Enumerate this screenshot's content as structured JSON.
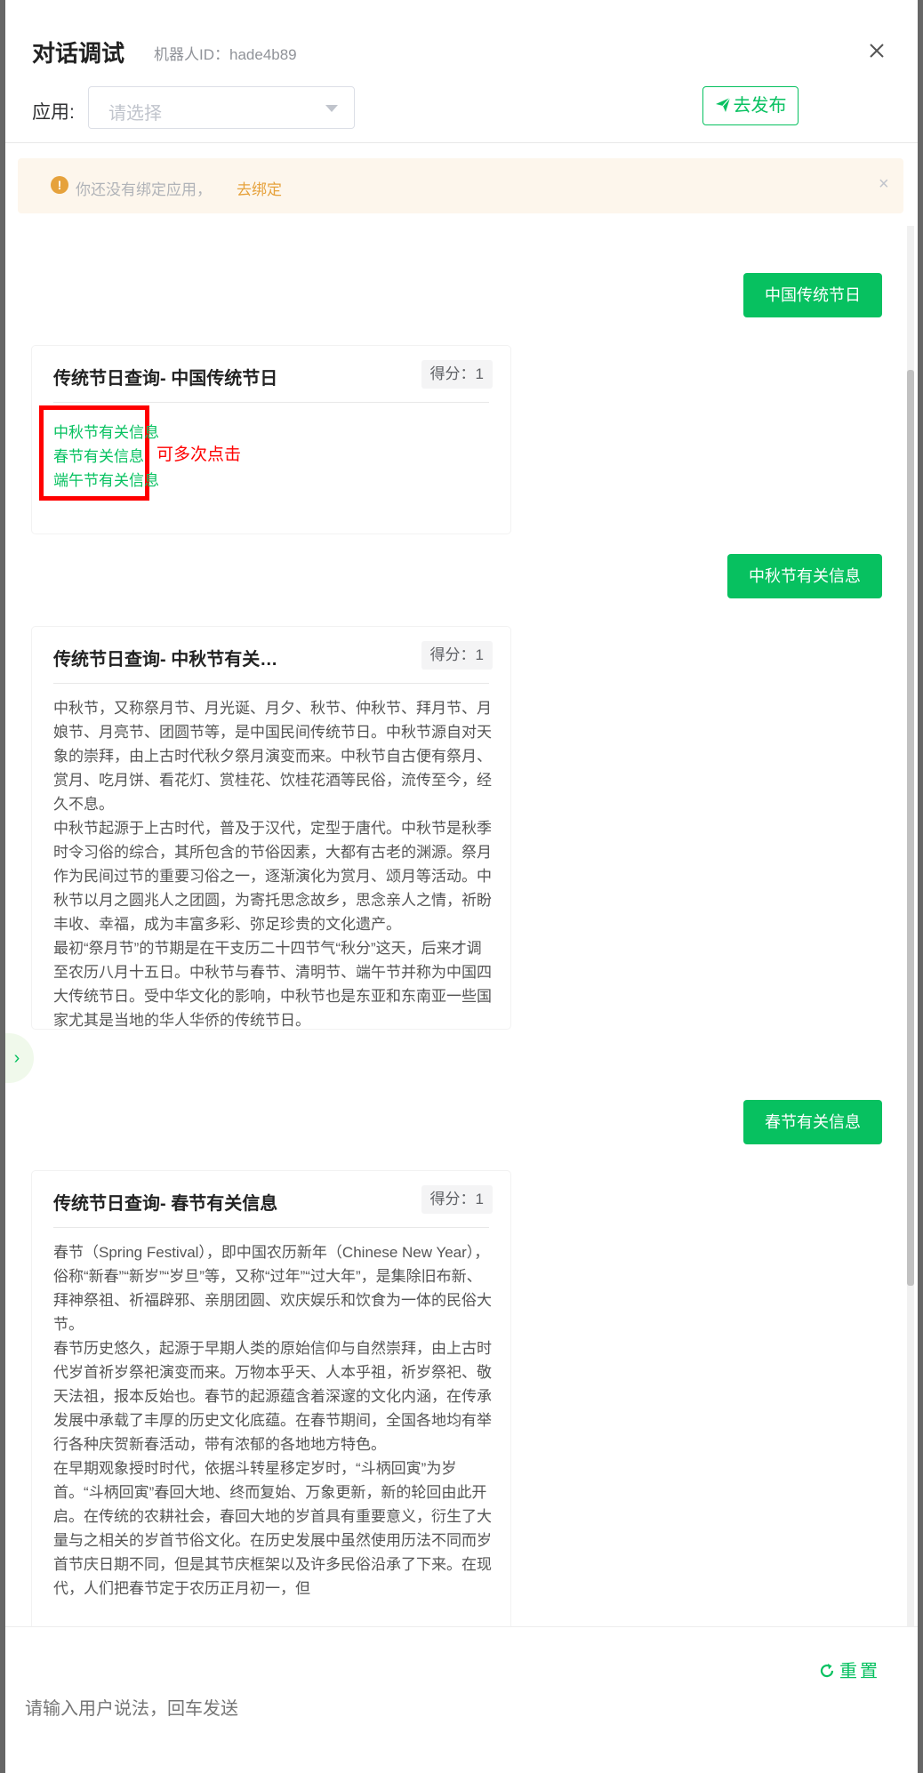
{
  "header": {
    "title": "对话调试",
    "robot_id": "机器人ID：hade4b89",
    "app_label": "应用:",
    "app_select_placeholder": "请选择",
    "publish_label": "去发布"
  },
  "alert": {
    "text": "你还没有绑定应用，",
    "link": "去绑定"
  },
  "messages": {
    "user1": "中国传统节日",
    "bot1": {
      "title": "传统节日查询- 中国传统节日",
      "score": "得分：1",
      "options": [
        "中秋节有关信息",
        "春节有关信息",
        "端午节有关信息"
      ],
      "note": "可多次点击"
    },
    "user2": "中秋节有关信息",
    "bot2": {
      "title": "传统节日查询- 中秋节有关…",
      "score": "得分：1",
      "paragraphs": [
        "中秋节，又称祭月节、月光诞、月夕、秋节、仲秋节、拜月节、月娘节、月亮节、团圆节等，是中国民间传统节日。中秋节源自对天象的崇拜，由上古时代秋夕祭月演变而来。中秋节自古便有祭月、赏月、吃月饼、看花灯、赏桂花、饮桂花酒等民俗，流传至今，经久不息。",
        "中秋节起源于上古时代，普及于汉代，定型于唐代。中秋节是秋季时令习俗的综合，其所包含的节俗因素，大都有古老的渊源。祭月作为民间过节的重要习俗之一，逐渐演化为赏月、颂月等活动。中秋节以月之圆兆人之团圆，为寄托思念故乡，思念亲人之情，祈盼丰收、幸福，成为丰富多彩、弥足珍贵的文化遗产。",
        "最初“祭月节”的节期是在干支历二十四节气“秋分”这天，后来才调至农历八月十五日。中秋节与春节、清明节、端午节并称为中国四大传统节日。受中华文化的影响，中秋节也是东亚和东南亚一些国家尤其是当地的华人华侨的传统节日。"
      ]
    },
    "user3": "春节有关信息",
    "bot3": {
      "title": "传统节日查询- 春节有关信息",
      "score": "得分：1",
      "paragraphs": [
        "春节（Spring Festival），即中国农历新年（Chinese New Year），俗称“新春”“新岁”“岁旦”等，又称“过年”“过大年”，是集除旧布新、拜神祭祖、祈福辟邪、亲朋团圆、欢庆娱乐和饮食为一体的民俗大节。",
        "春节历史悠久，起源于早期人类的原始信仰与自然崇拜，由上古时代岁首祈岁祭祀演变而来。万物本乎天、人本乎祖，祈岁祭祀、敬天法祖，报本反始也。春节的起源蕴含着深邃的文化内涵，在传承发展中承载了丰厚的历史文化底蕴。在春节期间，全国各地均有举行各种庆贺新春活动，带有浓郁的各地地方特色。",
        "在早期观象授时时代，依据斗转星移定岁时，“斗柄回寅”为岁首。“斗柄回寅”春回大地、终而复始、万象更新，新的轮回由此开启。在传统的农耕社会，春回大地的岁首具有重要意义，衍生了大量与之相关的岁首节俗文化。在历史发展中虽然使用历法不同而岁首节庆日期不同，但是其节庆框架以及许多民俗沿承了下来。在现代，人们把春节定于农历正月初一，但"
      ]
    }
  },
  "footer": {
    "reset_label": "重置",
    "input_placeholder": "请输入用户说法，回车发送"
  },
  "colors": {
    "accent": "#07c160",
    "warning": "#e6a23c",
    "annotation": "#ff0000"
  }
}
